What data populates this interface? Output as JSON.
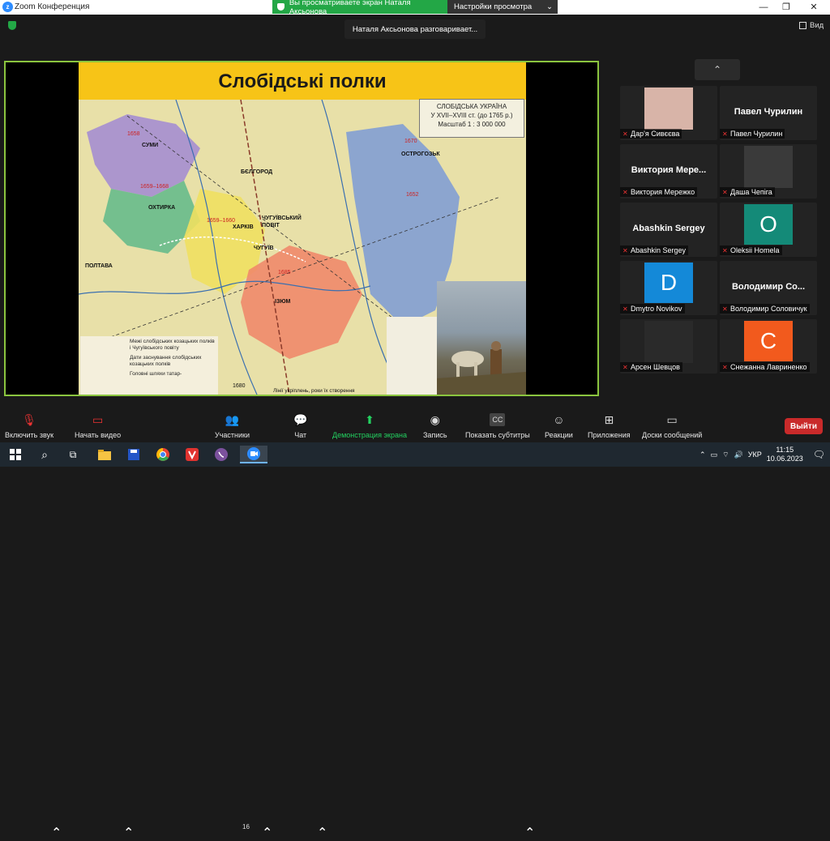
{
  "window": {
    "title": "Zoom Конференция",
    "view_label": "Вид"
  },
  "banner": {
    "viewing_text": "Вы просматриваете экран Наталя Аксьонова",
    "options_label": "Настройки просмотра"
  },
  "speaker_toast": "Наталя Аксьонова разговаривает...",
  "slide": {
    "title": "Слобідські полки",
    "legend_title": "СЛОБІДСЬКА УКРАЇНА",
    "legend_line2": "У XVII–XVIII ст. (до 1765 р.)",
    "legend_scale": "Масштаб 1 : 3 000 000",
    "map_labels": [
      "СУМИ",
      "ОХТИРКА",
      "ХАРКІВ",
      "БЄЛГОРОД",
      "ЧУГУЇВСЬКИЙ ПОВІТ",
      "ЧУГУЇВ",
      "ІЗЮМ",
      "ПОЛТАВА",
      "ОСТРОГОЗЬК"
    ],
    "years": [
      "1658",
      "1659–1668",
      "1659–1660",
      "1685",
      "1670",
      "1652",
      "1685",
      "1680"
    ],
    "bottom_legend": [
      "Межі слобідських козацьких полків і Чугуївського повіту",
      "Дати заснування слобідських козацьких полків",
      "Головні шляхи татар-"
    ],
    "bottom_note": "Лінії укріплень, роки їх створення"
  },
  "gallery": {
    "tiles": [
      {
        "name": "Дар'я Сивєєва",
        "kind": "photo",
        "muted": true,
        "color": "#d8b4a8"
      },
      {
        "name": "Павел Чурилин",
        "big": "Павел Чурилин",
        "kind": "name",
        "muted": true
      },
      {
        "name": "Виктория Мережко",
        "big": "Виктория Мере...",
        "kind": "name",
        "muted": true
      },
      {
        "name": "Даша Чепіга",
        "kind": "photo",
        "muted": true,
        "color": "#3a3a3a"
      },
      {
        "name": "Abashkin Sergey",
        "big": "Abashkin Sergey",
        "kind": "name",
        "muted": true
      },
      {
        "name": "Oleksii Homela",
        "kind": "avatar",
        "letter": "O",
        "color": "#148a78",
        "muted": true
      },
      {
        "name": "Dmytro Novikov",
        "kind": "avatar",
        "letter": "D",
        "color": "#1489d8",
        "muted": true
      },
      {
        "name": "Володимир Соловичук",
        "big": "Володимир Со...",
        "kind": "name",
        "muted": true
      },
      {
        "name": "Арсен Шевцов",
        "kind": "photo",
        "muted": true,
        "color": "#2a2a2a"
      },
      {
        "name": "Снежанна Лавриненко",
        "kind": "avatar",
        "letter": "С",
        "color": "#f25a1d",
        "muted": true
      }
    ]
  },
  "toolbar": {
    "unmute": "Включить звук",
    "start_video": "Начать видео",
    "participants": "Участники",
    "participants_count": "16",
    "chat": "Чат",
    "share_screen": "Демонстрация экрана",
    "record": "Запись",
    "captions": "Показать субтитры",
    "reactions": "Реакции",
    "apps": "Приложения",
    "whiteboards": "Доски сообщений",
    "leave": "Выйти"
  },
  "taskbar": {
    "lang": "УКР",
    "time": "11:15",
    "date": "10.06.2023"
  },
  "colors": {
    "accent_green": "#23a746",
    "share_border": "#8bc53f",
    "leave_red": "#c92a2a"
  }
}
